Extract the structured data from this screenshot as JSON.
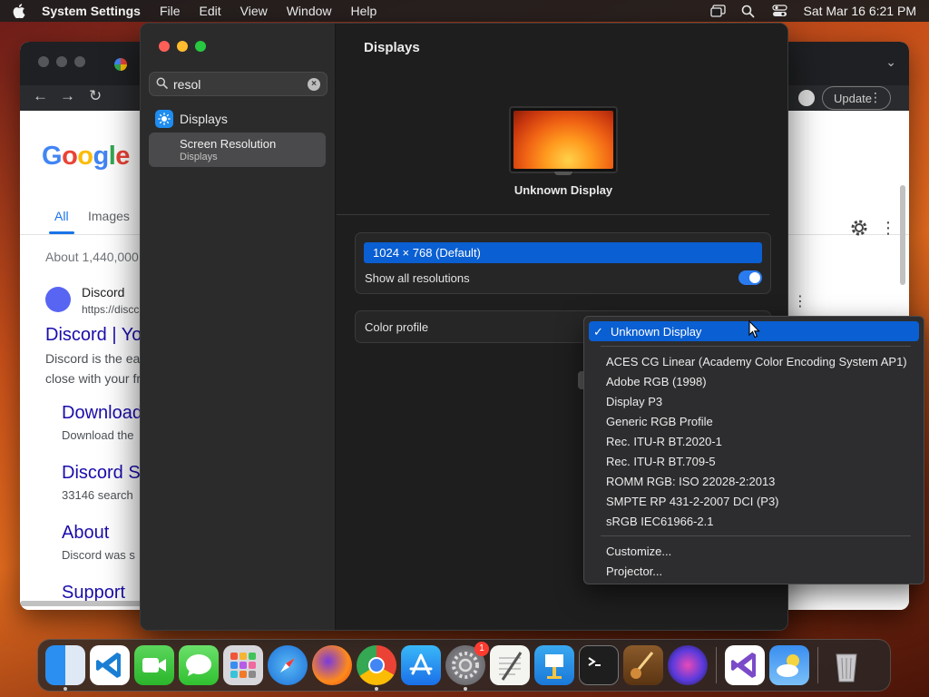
{
  "menubar": {
    "app_name": "System Settings",
    "items": [
      "File",
      "Edit",
      "View",
      "Window",
      "Help"
    ],
    "datetime": "Sat Mar 16  6:21 PM"
  },
  "chrome": {
    "update_label": "Update",
    "tabs": [
      "All",
      "Images"
    ],
    "about": "About 1,440,000",
    "result": {
      "site_name": "Discord",
      "site_url": "https://discc",
      "title": "Discord | Yo",
      "snippet_line1": "Discord is the ea",
      "snippet_line2": "close with your fr"
    },
    "sublinks": [
      {
        "title": "Download",
        "desc": "Download the"
      },
      {
        "title": "Discord S",
        "desc": "33146 search"
      },
      {
        "title": "About",
        "desc": "Discord was s"
      },
      {
        "title": "Support",
        "desc": ""
      }
    ]
  },
  "settings": {
    "search": {
      "value": "resol"
    },
    "sidebar": {
      "displays_label": "Displays",
      "selected_title": "Screen Resolution",
      "selected_subtitle": "Displays"
    },
    "title": "Displays",
    "display_name": "Unknown Display",
    "resolution_selected": "1024 × 768 (Default)",
    "show_all_label": "Show all resolutions",
    "show_all_on": true,
    "color_profile_label": "Color profile"
  },
  "color_menu": {
    "selected": "Unknown Display",
    "group1": [
      "ACES CG Linear (Academy Color Encoding System AP1)",
      "Adobe RGB (1998)",
      "Display P3",
      "Generic RGB Profile",
      "Rec. ITU-R BT.2020-1",
      "Rec. ITU-R BT.709-5",
      "ROMM RGB: ISO 22028-2:2013",
      "SMPTE RP 431-2-2007 DCI (P3)",
      "sRGB IEC61966-2.1"
    ],
    "group2": [
      "Customize...",
      "Projector..."
    ]
  },
  "dock": {
    "apps": [
      "finder-icon",
      "vscode-icon",
      "facetime-icon",
      "messages-icon",
      "launchpad-icon",
      "safari-icon",
      "firefox-icon",
      "chrome-icon",
      "app-store-icon",
      "system-settings-icon",
      "textedit-icon",
      "keynote-icon",
      "terminal-icon",
      "instruments-icon",
      "siri-icon",
      "visual-studio-icon",
      "weather-icon",
      "trash-icon"
    ],
    "settings_badge": "1"
  },
  "colors": {
    "accent": "#0a5fd2",
    "toggle_on": "#2a7bf0"
  }
}
